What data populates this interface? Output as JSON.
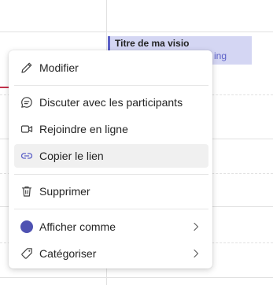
{
  "event": {
    "title": "Titre de ma visio",
    "subtitle_fragment": "ing"
  },
  "menu": {
    "items": [
      {
        "label": "Modifier",
        "icon": "pencil-icon"
      },
      {
        "label": "Discuter avec les participants",
        "icon": "chat-icon"
      },
      {
        "label": "Rejoindre en ligne",
        "icon": "video-icon"
      },
      {
        "label": "Copier le lien",
        "icon": "link-icon",
        "highlighted": true
      },
      {
        "label": "Supprimer",
        "icon": "trash-icon"
      },
      {
        "label": "Afficher comme",
        "icon": "color-dot-icon",
        "submenu": true
      },
      {
        "label": "Catégoriser",
        "icon": "tag-icon",
        "submenu": true
      }
    ]
  },
  "colors": {
    "accent": "#5b5fc7",
    "event_bg": "#d4d6f3",
    "now_line": "#c4314b",
    "status_dot": "#4f52b2"
  }
}
